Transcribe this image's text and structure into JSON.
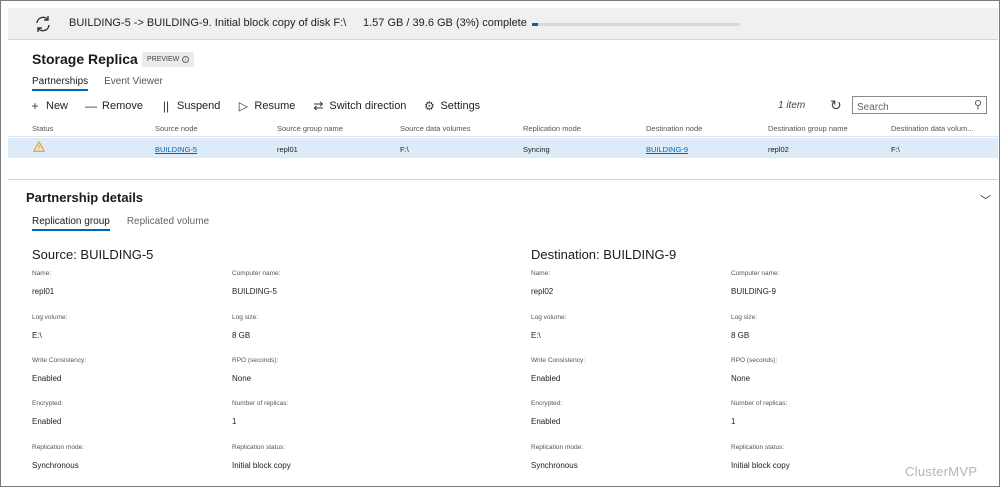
{
  "banner": {
    "message": "BUILDING-5 -> BUILDING-9. Initial block copy of disk F:\\",
    "progress_text": "1.57 GB / 39.6 GB (3%) complete",
    "progress_fraction": 0.03
  },
  "header": {
    "title": "Storage Replica",
    "badge": "PREVIEW",
    "tabs": [
      "Partnerships",
      "Event Viewer"
    ]
  },
  "toolbar": {
    "new": "New",
    "remove": "Remove",
    "suspend": "Suspend",
    "resume": "Resume",
    "switch": "Switch direction",
    "settings": "Settings",
    "count": "1 item",
    "search_placeholder": "Search"
  },
  "table": {
    "columns": [
      "Status",
      "Source node",
      "Source group name",
      "Source data volumes",
      "Replication mode",
      "Destination node",
      "Destination group name",
      "Destination data volum..."
    ],
    "rows": [
      {
        "status": "warning",
        "source_node": "BUILDING-5",
        "source_group": "repl01",
        "source_volumes": "F:\\",
        "mode": "Syncing",
        "dest_node": "BUILDING-9",
        "dest_group": "repl02",
        "dest_volumes": "F:\\"
      }
    ]
  },
  "details": {
    "title": "Partnership details",
    "tabs": [
      "Replication group",
      "Replicated volume"
    ],
    "source": {
      "title": "Source: BUILDING-5",
      "name_label": "Name:",
      "name": "repl01",
      "computer_label": "Computer name:",
      "computer": "BUILDING-5",
      "logvol_label": "Log volume:",
      "logvol": "E:\\",
      "logsize_label": "Log size:",
      "logsize": "8 GB",
      "wc_label": "Write Consistency:",
      "wc": "Enabled",
      "rpo_label": "RPO (seconds):",
      "rpo": "None",
      "enc_label": "Encrypted:",
      "enc": "Enabled",
      "replicas_label": "Number of replicas:",
      "replicas": "1",
      "mode_label": "Replication mode:",
      "mode": "Synchronous",
      "status_label": "Replication status:",
      "status": "Initial block copy"
    },
    "destination": {
      "title": "Destination: BUILDING-9",
      "name_label": "Name:",
      "name": "repl02",
      "computer_label": "Computer name:",
      "computer": "BUILDING-9",
      "logvol_label": "Log volume:",
      "logvol": "E:\\",
      "logsize_label": "Log size:",
      "logsize": "8 GB",
      "wc_label": "Write Consistency:",
      "wc": "Enabled",
      "rpo_label": "RPO (seconds):",
      "rpo": "None",
      "enc_label": "Encrypted:",
      "enc": "Enabled",
      "replicas_label": "Number of replicas:",
      "replicas": "1",
      "mode_label": "Replication mode:",
      "mode": "Synchronous",
      "status_label": "Replication status:",
      "status": "Initial block copy"
    }
  },
  "watermark": "ClusterMVP",
  "colors": {
    "accent": "#0067b8",
    "selected_row": "#ddeaf7",
    "warning": "#e8a317"
  }
}
